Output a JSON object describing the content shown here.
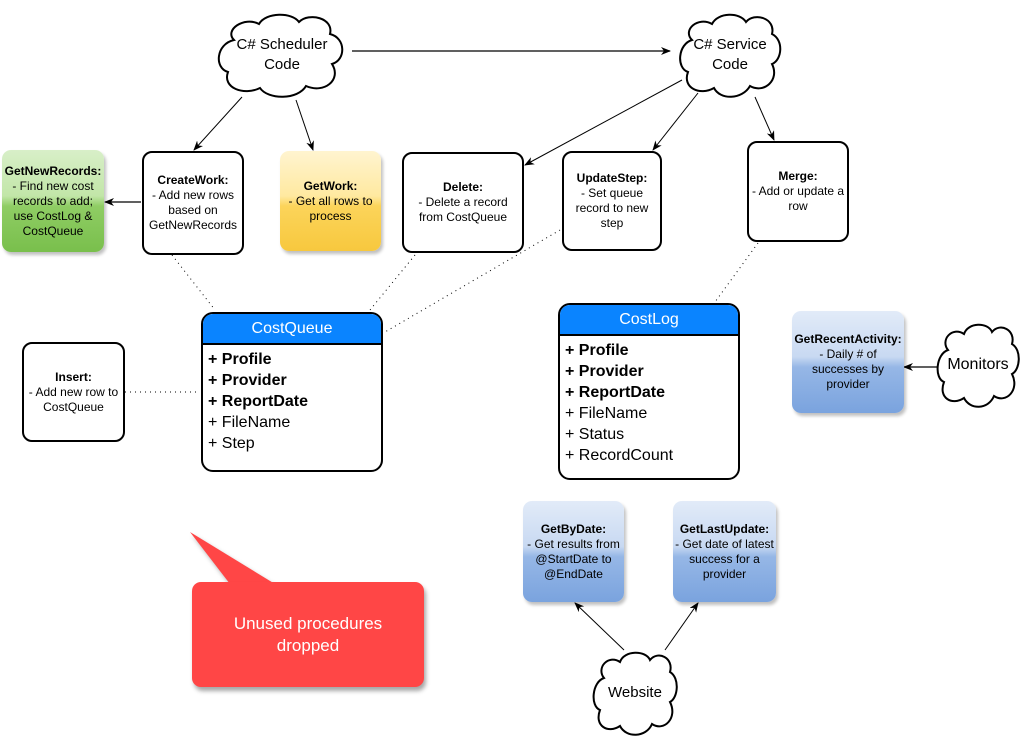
{
  "clouds": {
    "scheduler": "C# Scheduler\nCode",
    "service": "C# Service\nCode",
    "monitors": "Monitors",
    "website": "Website"
  },
  "procedures": {
    "get_new_records": {
      "title": "GetNewRecords:",
      "desc": "- Find new cost records to add; use CostLog & CostQueue",
      "color": "#79bf4c"
    },
    "create_work": {
      "title": "CreateWork:",
      "desc": "- Add new rows based on GetNewRecords"
    },
    "get_work": {
      "title": "GetWork:",
      "desc": "- Get all rows to process",
      "color": "#f7c83e"
    },
    "delete": {
      "title": "Delete:",
      "desc": "- Delete a record from CostQueue"
    },
    "update_step": {
      "title": "UpdateStep:",
      "desc": "- Set queue record to new step"
    },
    "merge": {
      "title": "Merge:",
      "desc": "- Add or update a row"
    },
    "insert": {
      "title": "Insert:",
      "desc": "- Add new row to CostQueue"
    },
    "get_recent_activity": {
      "title": "GetRecentActivity:",
      "desc": "- Daily # of successes by provider",
      "color": "#7aa3de"
    },
    "get_by_date": {
      "title": "GetByDate:",
      "desc": "- Get results from @StartDate to @EndDate",
      "color": "#7aa3de"
    },
    "get_last_update": {
      "title": "GetLastUpdate:",
      "desc": "- Get date of latest success for a provider",
      "color": "#7aa3de"
    }
  },
  "tables": {
    "cost_queue": {
      "name": "CostQueue",
      "header_color": "#0a84ff",
      "fields": [
        {
          "label": "+ Profile",
          "key": true
        },
        {
          "label": "+ Provider",
          "key": true
        },
        {
          "label": "+ ReportDate",
          "key": true
        },
        {
          "label": "+ FileName",
          "key": false
        },
        {
          "label": "+ Step",
          "key": false
        }
      ]
    },
    "cost_log": {
      "name": "CostLog",
      "header_color": "#0a84ff",
      "fields": [
        {
          "label": "+ Profile",
          "key": true
        },
        {
          "label": "+ Provider",
          "key": true
        },
        {
          "label": "+ ReportDate",
          "key": true
        },
        {
          "label": "+ FileName",
          "key": false
        },
        {
          "label": "+ Status",
          "key": false
        },
        {
          "label": "+ RecordCount",
          "key": false
        }
      ]
    }
  },
  "callout": {
    "text": "Unused procedures\ndropped",
    "color": "#ff4646"
  },
  "edges": [
    {
      "from": "C# Scheduler Code",
      "to": "C# Service Code",
      "style": "arrow"
    },
    {
      "from": "C# Scheduler Code",
      "to": "CreateWork",
      "style": "arrow"
    },
    {
      "from": "C# Scheduler Code",
      "to": "GetWork",
      "style": "arrow"
    },
    {
      "from": "CreateWork",
      "to": "GetNewRecords",
      "style": "arrow"
    },
    {
      "from": "C# Service Code",
      "to": "Delete",
      "style": "arrow"
    },
    {
      "from": "C# Service Code",
      "to": "UpdateStep",
      "style": "arrow"
    },
    {
      "from": "C# Service Code",
      "to": "Merge",
      "style": "arrow"
    },
    {
      "from": "Monitors",
      "to": "GetRecentActivity",
      "style": "arrow"
    },
    {
      "from": "Website",
      "to": "GetByDate",
      "style": "arrow"
    },
    {
      "from": "Website",
      "to": "GetLastUpdate",
      "style": "arrow"
    },
    {
      "from": "CreateWork",
      "to": "CostQueue",
      "style": "dotted"
    },
    {
      "from": "Delete",
      "to": "CostQueue",
      "style": "dotted"
    },
    {
      "from": "UpdateStep",
      "to": "CostQueue",
      "style": "dotted"
    },
    {
      "from": "Insert",
      "to": "CostQueue",
      "style": "dotted"
    },
    {
      "from": "Merge",
      "to": "CostLog",
      "style": "dotted"
    }
  ]
}
